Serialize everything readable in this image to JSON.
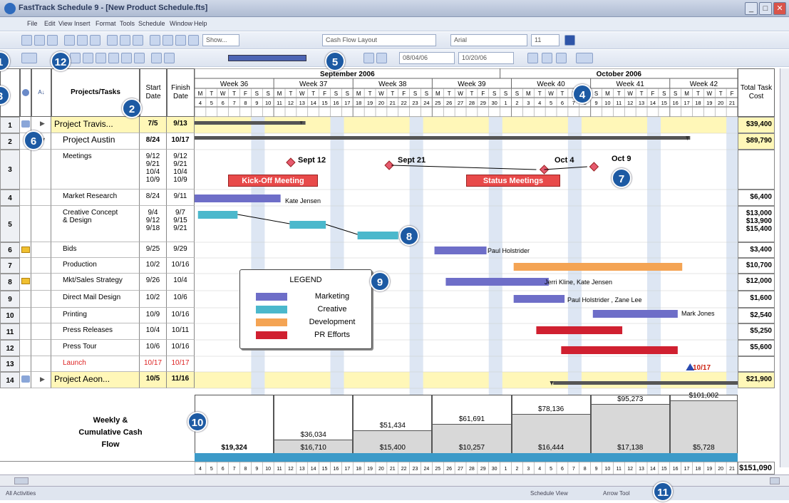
{
  "window": {
    "title": "FastTrack Schedule 9 - [New Product Schedule.fts]"
  },
  "menu": [
    "File",
    "Edit",
    "View",
    "Insert",
    "Format",
    "Tools",
    "Schedule",
    "Window",
    "Help"
  ],
  "toolbar": {
    "show_label": "Show...",
    "layout_label": "Cash Flow Layout",
    "font_label": "Arial",
    "size_label": "11",
    "date1_label": "08/04/06",
    "date2_label": "10/20/06"
  },
  "callouts": [
    "1",
    "2",
    "3",
    "4",
    "5",
    "6",
    "7",
    "8",
    "9",
    "10",
    "11",
    "12"
  ],
  "header": {
    "projects_tasks": "Projects/Tasks",
    "start_date": "Start Date",
    "finish_date": "Finish Date",
    "total_cost": "Total Task Cost",
    "months": [
      "September 2006",
      "October 2006"
    ],
    "weeks": [
      "Week 36",
      "Week 37",
      "Week 38",
      "Week 39",
      "Week 40",
      "Week 41",
      "Week 42"
    ],
    "days": [
      "M",
      "T",
      "W",
      "T",
      "F",
      "S",
      "S",
      "M",
      "T",
      "W",
      "T",
      "F",
      "S",
      "S",
      "M",
      "T",
      "W",
      "T",
      "F",
      "S",
      "S",
      "M",
      "T",
      "W",
      "T",
      "F",
      "S",
      "S",
      "S",
      "M",
      "T",
      "W",
      "T",
      "F",
      "S",
      "S",
      "M",
      "T",
      "W",
      "T",
      "F",
      "S",
      "S",
      "M",
      "T",
      "W",
      "T",
      "F",
      "S"
    ],
    "dates": [
      "4",
      "5",
      "6",
      "7",
      "8",
      "9",
      "10",
      "11",
      "12",
      "13",
      "14",
      "15",
      "16",
      "17",
      "18",
      "19",
      "20",
      "21",
      "22",
      "23",
      "24",
      "25",
      "26",
      "27",
      "28",
      "29",
      "30",
      "1",
      "2",
      "3",
      "4",
      "5",
      "6",
      "7",
      "8",
      "9",
      "10",
      "11",
      "12",
      "13",
      "14",
      "15",
      "16",
      "17",
      "18",
      "19",
      "20",
      "21"
    ]
  },
  "rows": [
    {
      "n": "1",
      "name": "Project Travis...",
      "start": "7/5",
      "finish": "9/13",
      "cost": "$39,400"
    },
    {
      "n": "2",
      "name": "Project Austin",
      "start": "8/24",
      "finish": "10/17",
      "cost": "$89,790"
    },
    {
      "n": "3",
      "name": "Meetings",
      "start": "9/12\n9/21\n10/4\n10/9",
      "finish": "9/12\n9/21\n10/4\n10/9",
      "cost": ""
    },
    {
      "n": "4",
      "name": "Market Research",
      "start": "8/24",
      "finish": "9/11",
      "cost": "$6,400"
    },
    {
      "n": "5",
      "name": "Creative Concept\n& Design",
      "start": "9/4\n9/12\n9/18",
      "finish": "9/7\n9/15\n9/21",
      "cost": "$13,000\n$13,900\n$15,400"
    },
    {
      "n": "6",
      "name": "Bids",
      "start": "9/25",
      "finish": "9/29",
      "cost": "$3,400"
    },
    {
      "n": "7",
      "name": "Production",
      "start": "10/2",
      "finish": "10/16",
      "cost": "$10,700"
    },
    {
      "n": "8",
      "name": "Mkt/Sales Strategy",
      "start": "9/26",
      "finish": "10/4",
      "cost": "$12,000"
    },
    {
      "n": "9",
      "name": "Direct Mail Design",
      "start": "10/2",
      "finish": "10/6",
      "cost": "$1,600"
    },
    {
      "n": "10",
      "name": "Printing",
      "start": "10/9",
      "finish": "10/16",
      "cost": "$2,540"
    },
    {
      "n": "11",
      "name": "Press Releases",
      "start": "10/4",
      "finish": "10/11",
      "cost": "$5,250"
    },
    {
      "n": "12",
      "name": "Press Tour",
      "start": "10/6",
      "finish": "10/16",
      "cost": "$5,600"
    },
    {
      "n": "13",
      "name": "Launch",
      "start": "10/17",
      "finish": "10/17",
      "cost": ""
    },
    {
      "n": "14",
      "name": "Project Aeon...",
      "start": "10/5",
      "finish": "11/16",
      "cost": "$21,900"
    }
  ],
  "gantt": {
    "milestones": [
      "Sept 12",
      "Sept 21",
      "Oct 4",
      "Oct 9"
    ],
    "kickoff": "Kick-Off Meeting",
    "status": "Status Meetings",
    "resources": {
      "market_research": "Kate Jensen",
      "bids": "Paul Holstrider",
      "mkt_strategy": "Jerri Kline, Kate Jensen",
      "direct_mail": "Paul Holstrider , Zane Lee",
      "printing": "Mark Jones"
    },
    "launch_label": "10/17"
  },
  "legend": {
    "title": "LEGEND",
    "items": [
      {
        "label": "Marketing",
        "color": "#6e6ec8"
      },
      {
        "label": "Creative",
        "color": "#4bb8cc"
      },
      {
        "label": "Development",
        "color": "#f4a454"
      },
      {
        "label": "PR Efforts",
        "color": "#d02030"
      }
    ]
  },
  "cashflow": {
    "label": "Weekly & Cumulative Cash Flow",
    "weekly": [
      "$19,324",
      "$16,710",
      "$15,400",
      "$10,257",
      "$16,444",
      "$17,138",
      "$5,728"
    ],
    "cumulative": [
      "",
      "$36,034",
      "$51,434",
      "$61,691",
      "$78,136",
      "$95,273",
      "$101,002"
    ],
    "total": "$151,090"
  },
  "status": {
    "left": "All Activities",
    "view": "Schedule View",
    "tool": "Arrow Tool"
  }
}
